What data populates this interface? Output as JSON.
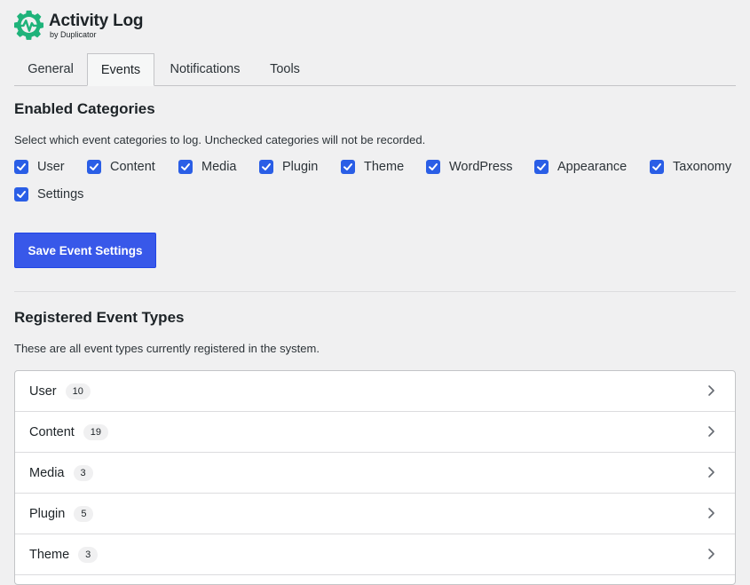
{
  "brand": {
    "title": "Activity Log",
    "subtitle": "by Duplicator",
    "color": "#1eb37a"
  },
  "tabs": [
    {
      "label": "General",
      "active": false
    },
    {
      "label": "Events",
      "active": true
    },
    {
      "label": "Notifications",
      "active": false
    },
    {
      "label": "Tools",
      "active": false
    }
  ],
  "enabled_categories": {
    "heading": "Enabled Categories",
    "description": "Select which event categories to log. Unchecked categories will not be recorded.",
    "items": [
      {
        "label": "User",
        "checked": true
      },
      {
        "label": "Content",
        "checked": true
      },
      {
        "label": "Media",
        "checked": true
      },
      {
        "label": "Plugin",
        "checked": true
      },
      {
        "label": "Theme",
        "checked": true
      },
      {
        "label": "WordPress",
        "checked": true
      },
      {
        "label": "Appearance",
        "checked": true
      },
      {
        "label": "Taxonomy",
        "checked": true
      },
      {
        "label": "Settings",
        "checked": true
      }
    ],
    "save_label": "Save Event Settings"
  },
  "registered": {
    "heading": "Registered Event Types",
    "description": "These are all event types currently registered in the system.",
    "rows": [
      {
        "name": "User",
        "count": "10"
      },
      {
        "name": "Content",
        "count": "19"
      },
      {
        "name": "Media",
        "count": "3"
      },
      {
        "name": "Plugin",
        "count": "5"
      },
      {
        "name": "Theme",
        "count": "3"
      }
    ]
  },
  "colors": {
    "accent": "#3858e9",
    "checkbox": "#2a5ee6",
    "background": "#f0f0f1"
  },
  "icons": {
    "logo": "gear-pulse-icon",
    "check": "checkmark-icon",
    "row_arrow": "chevron-right-icon"
  }
}
